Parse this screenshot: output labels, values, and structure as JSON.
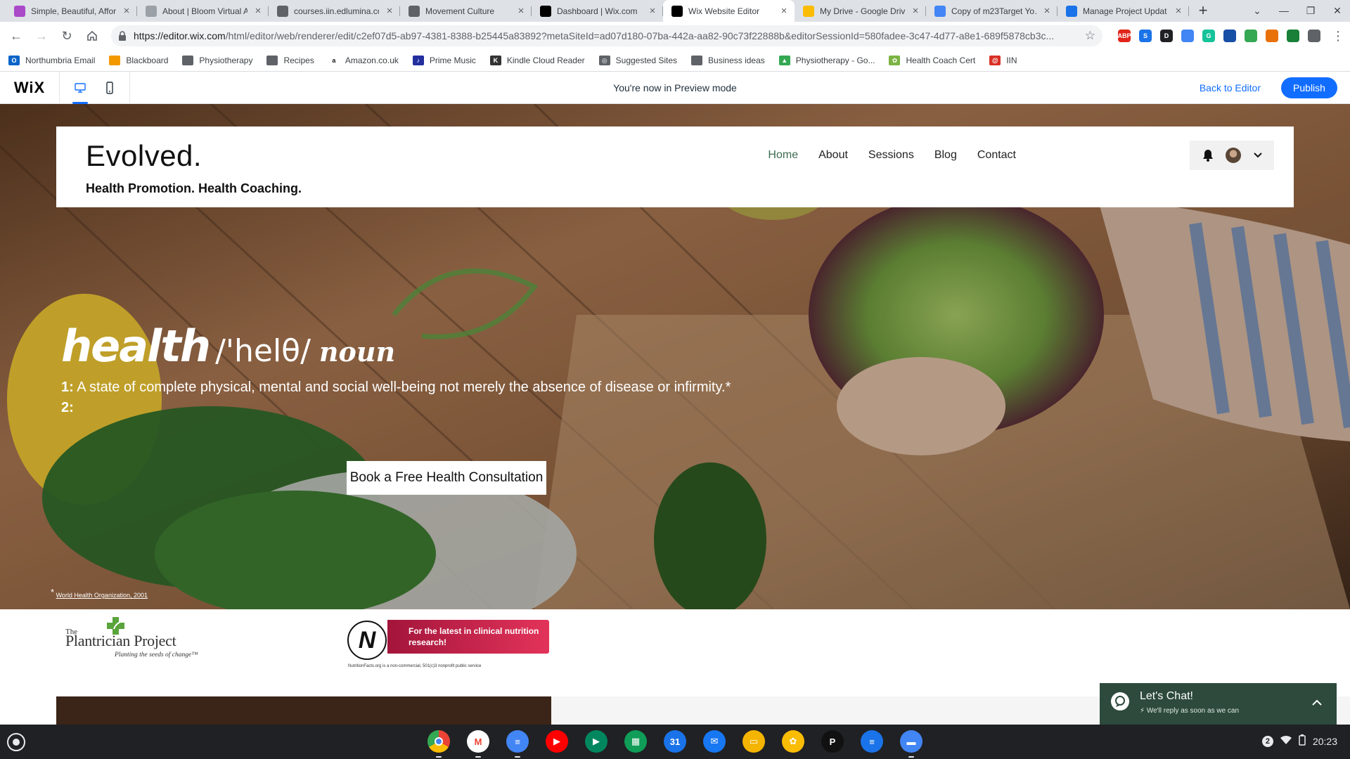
{
  "browser": {
    "tabs": [
      {
        "title": "Simple, Beautiful, Afford…",
        "icon": "flower-icon",
        "color": "#a94ac9"
      },
      {
        "title": "About | Bloom Virtual A…",
        "icon": "arrow-icon",
        "color": "#9aa0a6"
      },
      {
        "title": "courses.iin.edlumina.co…",
        "icon": "globe-icon",
        "color": "#5f6368"
      },
      {
        "title": "Movement Culture",
        "icon": "movement-icon",
        "color": "#5f6368"
      },
      {
        "title": "Dashboard | Wix.com",
        "icon": "wix-icon",
        "color": "#000000"
      },
      {
        "title": "Wix Website Editor",
        "icon": "wix-icon",
        "color": "#000000",
        "active": true
      },
      {
        "title": "My Drive - Google Drive",
        "icon": "drive-icon",
        "color": "#fbbc04"
      },
      {
        "title": "Copy of m23Target Yo…",
        "icon": "docs-icon",
        "color": "#4285f4"
      },
      {
        "title": "Manage Project Updat…",
        "icon": "gear-icon",
        "color": "#1a73e8"
      }
    ],
    "new_tab": "+",
    "url_host": "https://editor.wix.com",
    "url_path": "/html/editor/web/renderer/edit/c2ef07d5-ab97-4381-8388-b25445a83892?metaSiteId=ad07d180-07ba-442a-aa82-90c73f22888b&editorSessionId=580fadee-3c47-4d77-a8e1-689f5878cb3c...",
    "extensions": [
      {
        "name": "abp-icon",
        "color": "#e0241a",
        "label": "ABP"
      },
      {
        "name": "s-icon",
        "color": "#1a73e8",
        "label": "S"
      },
      {
        "name": "d-icon",
        "color": "#202124",
        "label": "D"
      },
      {
        "name": "screen-icon",
        "color": "#4285f4",
        "label": ""
      },
      {
        "name": "grammarly-icon",
        "color": "#15c39a",
        "label": "G"
      },
      {
        "name": "book-icon",
        "color": "#174ea6",
        "label": ""
      },
      {
        "name": "shield-icon",
        "color": "#34a853",
        "label": ""
      },
      {
        "name": "save-icon",
        "color": "#e8710a",
        "label": ""
      },
      {
        "name": "color-icon",
        "color": "#188038",
        "label": ""
      },
      {
        "name": "puzzle-icon",
        "color": "#5f6368",
        "label": ""
      }
    ],
    "bookmarks": [
      {
        "label": "Northumbria Email",
        "icon": "outlook-icon",
        "color": "#0a64c8",
        "glyph": "O"
      },
      {
        "label": "Blackboard",
        "icon": "blackboard-icon",
        "color": "#f29900",
        "glyph": ""
      },
      {
        "label": "Physiotherapy",
        "icon": "folder-icon",
        "folder": true
      },
      {
        "label": "Recipes",
        "icon": "folder-icon",
        "folder": true
      },
      {
        "label": "Amazon.co.uk",
        "icon": "amazon-icon",
        "color": "#ffffff",
        "glyph": "a"
      },
      {
        "label": "Prime Music",
        "icon": "prime-music-icon",
        "color": "#232f9e",
        "glyph": "♪"
      },
      {
        "label": "Kindle Cloud Reader",
        "icon": "kindle-icon",
        "color": "#333333",
        "glyph": "K"
      },
      {
        "label": "Suggested Sites",
        "icon": "globe-icon",
        "color": "#5f6368",
        "glyph": "◎"
      },
      {
        "label": "Business ideas",
        "icon": "folder-icon",
        "folder": true
      },
      {
        "label": "Physiotherapy - Go...",
        "icon": "drive-icon",
        "color": "#34a853",
        "glyph": "▲"
      },
      {
        "label": "Health Coach Cert",
        "icon": "leaf-icon",
        "color": "#7cb342",
        "glyph": "✿"
      },
      {
        "label": "IIN",
        "icon": "iin-icon",
        "color": "#d93025",
        "glyph": "@"
      }
    ],
    "clock": "20:23",
    "notification_count": "2"
  },
  "wix_bar": {
    "logo": "WiX",
    "status": "You're now in Preview mode",
    "back_label": "Back to Editor",
    "publish_label": "Publish",
    "accent": "#116dff"
  },
  "site": {
    "logo": "Evolved.",
    "tagline": "Health Promotion. Health Coaching.",
    "nav": [
      "Home",
      "About",
      "Sessions",
      "Blog",
      "Contact"
    ],
    "active_nav": "Home",
    "definition": {
      "word": "health",
      "pronunciation": "/'helθ/",
      "part_of_speech": "noun",
      "n1": "1:",
      "sense1": "A state of complete physical, mental and social well-being not merely the absence of disease or infirmity.*",
      "n2": "2:"
    },
    "cta": "Book a Free Health Consultation",
    "citation": "World Health Organization, 2001",
    "citation_mark": "*",
    "partners": {
      "plantrician_the": "The",
      "plantrician_name": "Plantrician Project",
      "plantrician_sub": "Planting the seeds of change™",
      "nf_banner": "For the latest in clinical nutrition research!",
      "nf_footer": "NutritionFacts.org is a non-commercial, 501(c)3 nonprofit public service",
      "nf_letter": "N"
    },
    "chat": {
      "title": "Let's Chat!",
      "subtitle": "We'll reply as soon as we can"
    }
  },
  "shelf": {
    "apps": [
      {
        "name": "chrome-icon",
        "color": "#ea4335",
        "glyph": ""
      },
      {
        "name": "gmail-icon",
        "color": "#ffffff",
        "glyph": "M"
      },
      {
        "name": "docs-icon",
        "color": "#4285f4",
        "glyph": "≡"
      },
      {
        "name": "youtube-icon",
        "color": "#ff0000",
        "glyph": "▶"
      },
      {
        "name": "play-store-icon",
        "color": "#01875f",
        "glyph": "▶"
      },
      {
        "name": "sheets-icon",
        "color": "#0f9d58",
        "glyph": "▦"
      },
      {
        "name": "calendar-icon",
        "color": "#1a73e8",
        "glyph": "31"
      },
      {
        "name": "messenger-icon",
        "color": "#1877f2",
        "glyph": "✉"
      },
      {
        "name": "slides-icon",
        "color": "#f4b400",
        "glyph": "▭"
      },
      {
        "name": "photos-icon",
        "color": "#fbbc04",
        "glyph": "✿"
      },
      {
        "name": "ip-icon",
        "color": "#111111",
        "glyph": "P"
      },
      {
        "name": "messages-icon",
        "color": "#1a73e8",
        "glyph": "≡"
      },
      {
        "name": "files-icon",
        "color": "#4285f4",
        "glyph": "▬"
      }
    ]
  }
}
